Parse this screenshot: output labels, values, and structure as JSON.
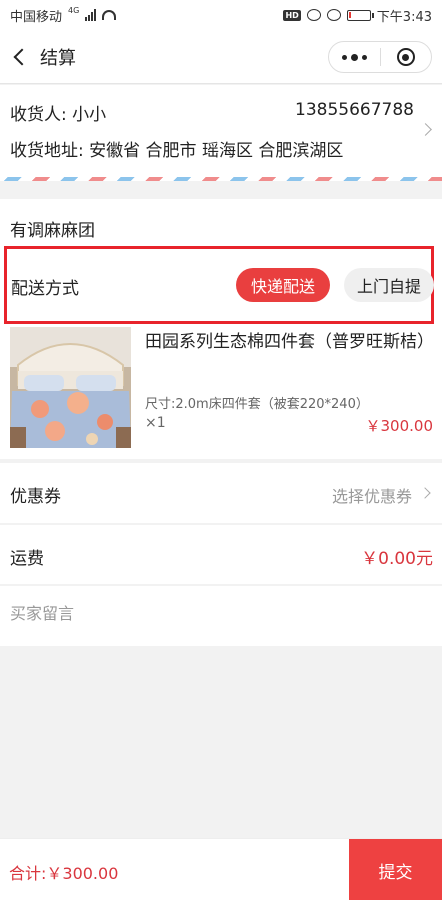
{
  "status_bar": {
    "carrier": "中国移动",
    "network": "4G",
    "hd": "HD",
    "time": "下午3:43",
    "battery_level": 0.12
  },
  "nav": {
    "title": "结算"
  },
  "address": {
    "receiver_label": "收货人: 小小",
    "phone": "13855667788",
    "address_label": "收货地址: 安徽省 合肥市 瑶海区 合肥滨湖区"
  },
  "shop": {
    "name": "有调麻麻团",
    "delivery": {
      "label": "配送方式",
      "express": "快递配送",
      "pickup": "上门自提",
      "selected": "快递配送"
    }
  },
  "product": {
    "name": "田园系列生态棉四件套（普罗旺斯桔）",
    "spec": "尺寸:2.0m床四件套（被套220*240）",
    "qty": "×1",
    "price": "￥300.00"
  },
  "coupon": {
    "label": "优惠券",
    "value": "选择优惠券"
  },
  "freight": {
    "label": "运费",
    "value": "￥0.00元"
  },
  "message": {
    "placeholder": "买家留言"
  },
  "footer": {
    "total": "合计:￥300.00",
    "submit": "提交"
  },
  "colors": {
    "accent": "#e93f3f",
    "price": "#d9363e",
    "highlight_frame": "#e8232b"
  }
}
